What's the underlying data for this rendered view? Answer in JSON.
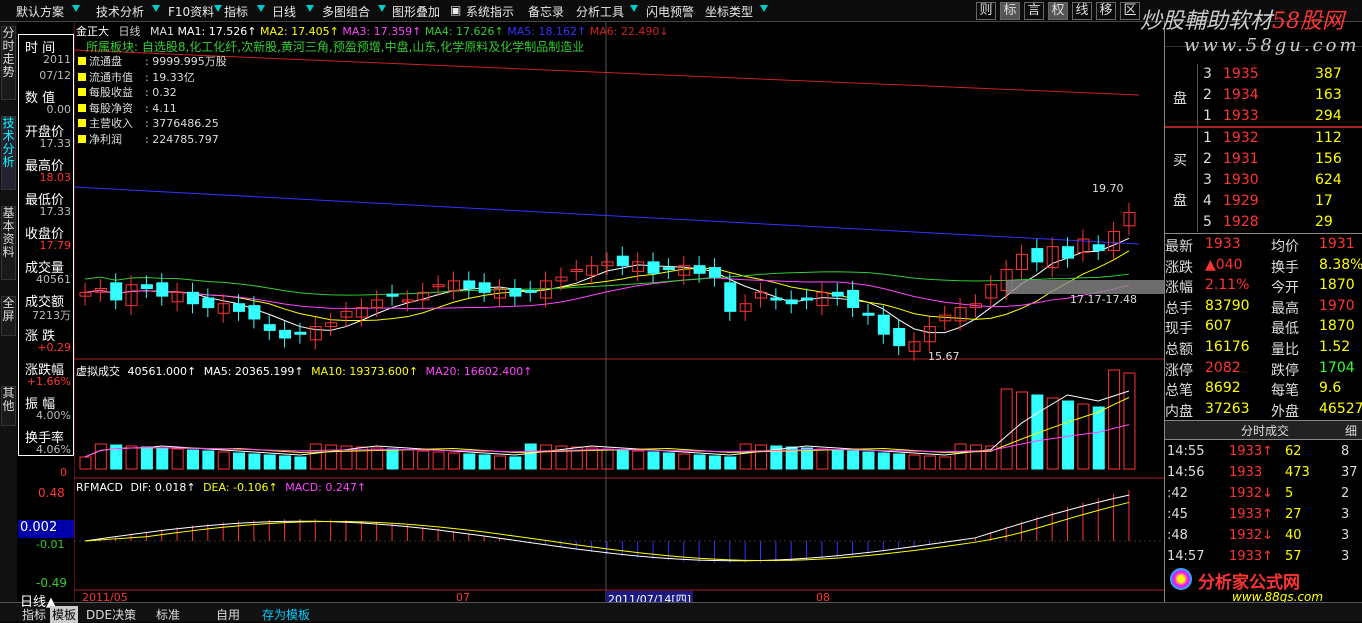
{
  "toolbar": {
    "items": [
      "默认方案",
      "技术分析",
      "F10资料",
      "指标",
      "日线",
      "多图组合",
      "图形叠加",
      "系统指示",
      "备忘录",
      "分析工具",
      "闪电预警",
      "坐标类型"
    ],
    "right_buttons": [
      "则",
      "标",
      "言",
      "权",
      "线",
      "移",
      "区"
    ],
    "logo_text": "炒股輔助软材",
    "logo_red": "58股网",
    "site": "www.58gu.com"
  },
  "vtabs": [
    "分时走势",
    "技术分析",
    "基本资料",
    "全屏",
    "其他"
  ],
  "info": {
    "labels": [
      "时 间",
      "数 值",
      "开盘价",
      "最高价",
      "最低价",
      "收盘价",
      "成交量",
      "成交额",
      "涨 跌",
      "涨跌幅",
      "振 幅",
      "换手率"
    ],
    "values": [
      "2011",
      "07/12",
      "0.00",
      "17.33",
      "18.03",
      "17.33",
      "17.79",
      "40561",
      "7213万",
      "+0.29",
      "+1.66%",
      "4.00%",
      "4.06%"
    ]
  },
  "main_chart": {
    "stock": "金正大",
    "period": "日线",
    "ma1": "MA1",
    "ma1_val": "MA1: 17.526↑",
    "ma2_val": "MA2: 17.405↑",
    "ma3_val": "MA3: 17.359↑",
    "ma4_val": "MA4: 17.626↑",
    "ma5_val": "MA5: 18.162↑",
    "ma6_val": "MA6: 22.490↓",
    "concept": "所属板块: 自选股8,化工化纤,次新股,黄河三角,预盈预增,中盘,山东,化学原料及化学制品制造业",
    "fund": [
      {
        "k": "流通盘",
        "v": "9999.995万股"
      },
      {
        "k": "流通市值",
        "v": "19.33亿"
      },
      {
        "k": "每股收益",
        "v": "0.32"
      },
      {
        "k": "每股净资",
        "v": "4.11"
      },
      {
        "k": "主营收入",
        "v": "3776486.25"
      },
      {
        "k": "净利润",
        "v": "224785.797"
      }
    ],
    "hi_label": "19.70",
    "lo_label": "15.67",
    "range_label": "17.17-17.48"
  },
  "vol_chart": {
    "title": "虚拟成交",
    "v1": "40561.000↑",
    "v2": "MA5: 20365.199↑",
    "v3": "MA10: 19373.600↑",
    "v4": "MA20: 16602.400↑",
    "zero": "0"
  },
  "macd_chart": {
    "title": "RFMACD",
    "dif": "DIF: 0.018↑",
    "dea": "DEA: -0.106↑",
    "macd": "MACD: 0.247↑",
    "top": "0.48",
    "val": "0.002",
    "mid": "-0.01",
    "bot": "-0.49"
  },
  "xaxis": {
    "d1": "2011/05",
    "d2": "07",
    "cursor": "2011/07/14[四]",
    "d3": "08"
  },
  "colors": {
    "up": "#ff3333",
    "down": "#33ffff",
    "ma_white": "#ffffff",
    "ma_yellow": "#ffff00",
    "ma_magenta": "#ff44ff",
    "ma_green": "#33cc33",
    "ma_blue": "#3333ff",
    "ma_red": "#cc2222"
  },
  "quote": {
    "sell": [
      {
        "n": "3",
        "p": "1935",
        "v": "387"
      },
      {
        "n": "2",
        "p": "1934",
        "v": "163"
      },
      {
        "n": "1",
        "p": "1933",
        "v": "294"
      }
    ],
    "buy": [
      {
        "n": "1",
        "p": "1932",
        "v": "112"
      },
      {
        "n": "2",
        "p": "1931",
        "v": "156"
      },
      {
        "n": "3",
        "p": "1930",
        "v": "624"
      },
      {
        "n": "4",
        "p": "1929",
        "v": "17"
      },
      {
        "n": "5",
        "p": "1928",
        "v": "29"
      }
    ],
    "sell_label": "盘",
    "buy_label1": "买",
    "buy_label2": "盘",
    "stats": [
      {
        "k1": "最新",
        "v1": "1933",
        "k2": "均价",
        "v2": "1931"
      },
      {
        "k1": "涨跌",
        "v1": "▲040",
        "k2": "换手",
        "v2": "8.38%"
      },
      {
        "k1": "涨幅",
        "v1": "2.11%",
        "k2": "今开",
        "v2": "1870"
      },
      {
        "k1": "总手",
        "v1": "83790",
        "k2": "最高",
        "v2": "1970"
      },
      {
        "k1": "现手",
        "v1": "607",
        "k2": "最低",
        "v2": "1870"
      },
      {
        "k1": "总额",
        "v1": "16176",
        "k2": "量比",
        "v2": "1.52"
      },
      {
        "k1": "涨停",
        "v1": "2082",
        "k2": "跌停",
        "v2": "1704"
      },
      {
        "k1": "总笔",
        "v1": "8692",
        "k2": "每笔",
        "v2": "9.6"
      },
      {
        "k1": "内盘",
        "v1": "37263",
        "k2": "外盘",
        "v2": "46527"
      }
    ],
    "ticks_title": "分时成交",
    "ticks_btn": "细",
    "ticks": [
      {
        "t": "14:55",
        "p": "1933↑",
        "v": "62",
        "c": "8"
      },
      {
        "t": "14:56",
        "p": "1933",
        "v": "473",
        "c": "37"
      },
      {
        "t": ":42",
        "p": "1932↓",
        "v": "5",
        "c": "2"
      },
      {
        "t": ":45",
        "p": "1933↑",
        "v": "27",
        "c": "3"
      },
      {
        "t": ":48",
        "p": "1932↓",
        "v": "40",
        "c": "3"
      },
      {
        "t": "14:57",
        "p": "1933↑",
        "v": "57",
        "c": "3"
      }
    ]
  },
  "watermark": {
    "brand": "分析家公式网",
    "url": "www.88gs.com"
  },
  "bottom": {
    "items": [
      "日线▲",
      "指标",
      "模板",
      "DDE决策",
      "标准",
      "自用",
      "存为模板"
    ]
  }
}
